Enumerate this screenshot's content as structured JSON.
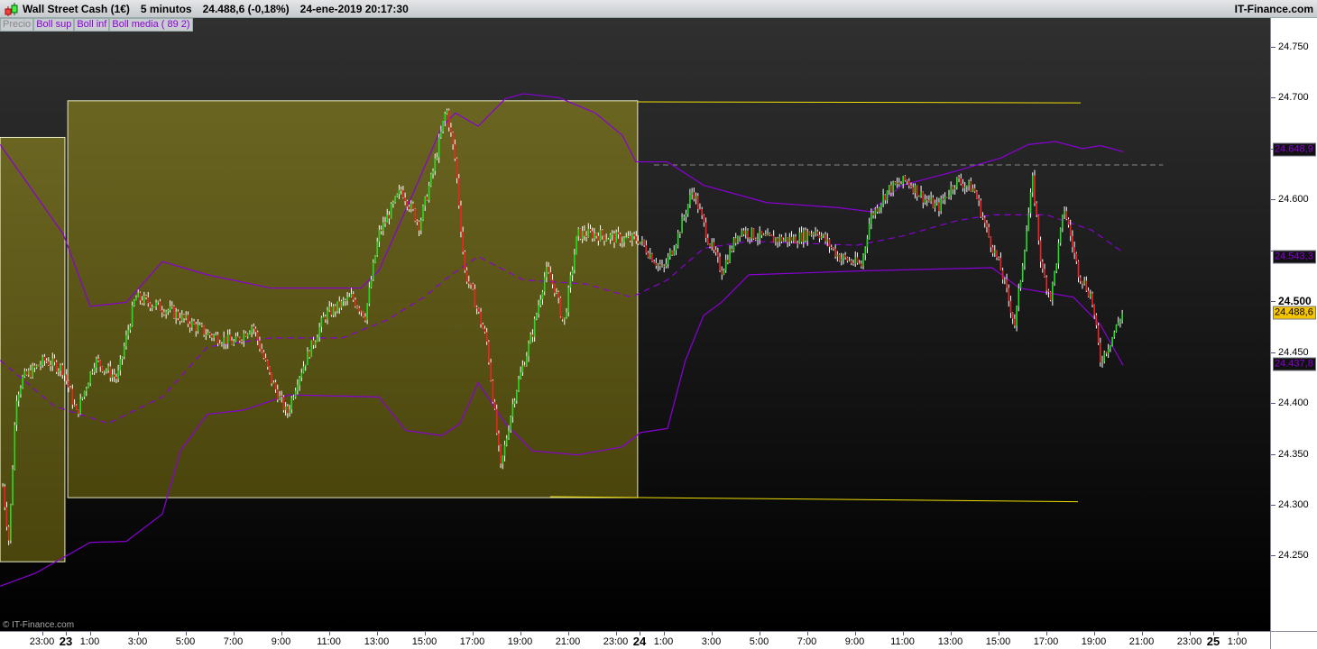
{
  "header": {
    "instrument": "Wall Street Cash (1€)",
    "timeframe": "5 minutos",
    "last": "24.488,6 (-0,18%)",
    "datetime": "24-ene-2019 20:17:30",
    "brand": "IT-Finance.com"
  },
  "legend": [
    "Precio",
    "Boll sup",
    "Boll inf",
    "Boll media ( 89 2)"
  ],
  "copyright": "© IT-Finance.com",
  "colors": {
    "band": "#8a00d6",
    "box": "#6b6520",
    "line": "#f0e000",
    "up": "#22dd22",
    "down": "#ee2222"
  },
  "chart_data": {
    "type": "candlestick",
    "time_unit": "hours since 22-ene-2019 00:00",
    "ylim": [
      24.18,
      24.78
    ],
    "y_ticks": [
      {
        "v": 24.75,
        "label": "24.750"
      },
      {
        "v": 24.7,
        "label": "24.700"
      },
      {
        "v": 24.65,
        "label": ""
      },
      {
        "v": 24.6,
        "label": "24.600"
      },
      {
        "v": 24.55,
        "label": ""
      },
      {
        "v": 24.5,
        "label": "24.500",
        "bold": true
      },
      {
        "v": 24.45,
        "label": "24.450"
      },
      {
        "v": 24.4,
        "label": "24.400"
      },
      {
        "v": 24.35,
        "label": "24.350"
      },
      {
        "v": 24.3,
        "label": "24.300"
      },
      {
        "v": 24.25,
        "label": "24.250"
      }
    ],
    "x_ticks": [
      {
        "t": 23,
        "label": "23:00"
      },
      {
        "t": 24,
        "label": "23",
        "bold": true
      },
      {
        "t": 25,
        "label": "1:00"
      },
      {
        "t": 27,
        "label": "3:00"
      },
      {
        "t": 29,
        "label": "5:00"
      },
      {
        "t": 31,
        "label": "7:00"
      },
      {
        "t": 33,
        "label": "9:00"
      },
      {
        "t": 35,
        "label": "11:00"
      },
      {
        "t": 37,
        "label": "13:00"
      },
      {
        "t": 39,
        "label": "15:00"
      },
      {
        "t": 41,
        "label": "17:00"
      },
      {
        "t": 43,
        "label": "19:00"
      },
      {
        "t": 45,
        "label": "21:00"
      },
      {
        "t": 47,
        "label": "23:00"
      },
      {
        "t": 48,
        "label": "24",
        "bold": true
      },
      {
        "t": 49,
        "label": "1:00"
      },
      {
        "t": 51,
        "label": "3:00"
      },
      {
        "t": 53,
        "label": "5:00"
      },
      {
        "t": 55,
        "label": "7:00"
      },
      {
        "t": 57,
        "label": "9:00"
      },
      {
        "t": 59,
        "label": "11:00"
      },
      {
        "t": 61,
        "label": "13:00"
      },
      {
        "t": 63,
        "label": "15:00"
      },
      {
        "t": 65,
        "label": "17:00"
      },
      {
        "t": 67,
        "label": "19:00"
      },
      {
        "t": 69,
        "label": "21:00"
      },
      {
        "t": 71,
        "label": "23:00"
      },
      {
        "t": 72,
        "label": "25",
        "bold": true
      },
      {
        "t": 73,
        "label": "1:00"
      }
    ],
    "badges": [
      {
        "v": 24.6489,
        "label": "24.648,9",
        "kind": "band"
      },
      {
        "v": 24.5433,
        "label": "24.543,3",
        "kind": "band"
      },
      {
        "v": 24.4886,
        "label": "24.488,6",
        "kind": "last"
      },
      {
        "v": 24.4378,
        "label": "24.437,8",
        "kind": "band"
      }
    ],
    "price_path": [
      [
        21.36,
        24.318
      ],
      [
        21.62,
        24.264
      ],
      [
        21.92,
        24.406
      ],
      [
        22.19,
        24.424
      ],
      [
        23.13,
        24.442
      ],
      [
        23.89,
        24.433
      ],
      [
        24.45,
        24.389
      ],
      [
        25.21,
        24.442
      ],
      [
        26.15,
        24.424
      ],
      [
        26.91,
        24.504
      ],
      [
        28.42,
        24.49
      ],
      [
        29.92,
        24.468
      ],
      [
        31.06,
        24.459
      ],
      [
        31.81,
        24.477
      ],
      [
        32.57,
        24.424
      ],
      [
        33.25,
        24.389
      ],
      [
        33.7,
        24.424
      ],
      [
        34.83,
        24.486
      ],
      [
        35.96,
        24.504
      ],
      [
        36.53,
        24.486
      ],
      [
        37.09,
        24.566
      ],
      [
        38.04,
        24.61
      ],
      [
        38.79,
        24.575
      ],
      [
        39.36,
        24.628
      ],
      [
        39.92,
        24.69
      ],
      [
        40.3,
        24.637
      ],
      [
        40.68,
        24.53
      ],
      [
        41.06,
        24.504
      ],
      [
        41.62,
        24.459
      ],
      [
        42.19,
        24.335
      ],
      [
        42.75,
        24.406
      ],
      [
        43.51,
        24.468
      ],
      [
        44.08,
        24.53
      ],
      [
        44.45,
        24.513
      ],
      [
        44.83,
        24.477
      ],
      [
        45.4,
        24.566
      ],
      [
        46.15,
        24.566
      ],
      [
        47.28,
        24.561
      ],
      [
        47.96,
        24.561
      ],
      [
        48.98,
        24.53
      ],
      [
        49.55,
        24.561
      ],
      [
        50.23,
        24.61
      ],
      [
        50.87,
        24.561
      ],
      [
        51.43,
        24.53
      ],
      [
        52.19,
        24.57
      ],
      [
        53.32,
        24.561
      ],
      [
        54.45,
        24.561
      ],
      [
        55.4,
        24.57
      ],
      [
        56.34,
        24.544
      ],
      [
        57.28,
        24.535
      ],
      [
        57.66,
        24.583
      ],
      [
        58.42,
        24.61
      ],
      [
        59.17,
        24.619
      ],
      [
        59.92,
        24.601
      ],
      [
        60.49,
        24.592
      ],
      [
        61.25,
        24.619
      ],
      [
        62.0,
        24.61
      ],
      [
        62.57,
        24.566
      ],
      [
        63.13,
        24.53
      ],
      [
        63.7,
        24.477
      ],
      [
        64.45,
        24.619
      ],
      [
        64.83,
        24.53
      ],
      [
        65.21,
        24.504
      ],
      [
        65.77,
        24.592
      ],
      [
        66.34,
        24.53
      ],
      [
        66.91,
        24.504
      ],
      [
        67.28,
        24.442
      ],
      [
        67.66,
        24.459
      ],
      [
        68.23,
        24.49
      ]
    ],
    "series": [
      {
        "name": "Boll sup",
        "style": "solid",
        "points": [
          [
            21.25,
            24.654
          ],
          [
            23.89,
            24.566
          ],
          [
            25.02,
            24.495
          ],
          [
            26.53,
            24.499
          ],
          [
            28.04,
            24.539
          ],
          [
            29.92,
            24.526
          ],
          [
            32.57,
            24.513
          ],
          [
            36.34,
            24.513
          ],
          [
            37.09,
            24.53
          ],
          [
            38.6,
            24.61
          ],
          [
            39.74,
            24.672
          ],
          [
            40.3,
            24.685
          ],
          [
            41.25,
            24.672
          ],
          [
            42.38,
            24.699
          ],
          [
            43.13,
            24.704
          ],
          [
            44.64,
            24.7
          ],
          [
            46.15,
            24.685
          ],
          [
            47.28,
            24.663
          ],
          [
            47.85,
            24.637
          ],
          [
            49.17,
            24.637
          ],
          [
            50.68,
            24.614
          ],
          [
            53.32,
            24.597
          ],
          [
            56.34,
            24.592
          ],
          [
            57.66,
            24.588
          ],
          [
            58.98,
            24.614
          ],
          [
            61.25,
            24.628
          ],
          [
            63.13,
            24.641
          ],
          [
            64.26,
            24.654
          ],
          [
            65.4,
            24.657
          ],
          [
            66.53,
            24.65
          ],
          [
            67.28,
            24.653
          ],
          [
            68.23,
            24.647
          ]
        ]
      },
      {
        "name": "Boll inf",
        "style": "solid",
        "points": [
          [
            21.25,
            24.22
          ],
          [
            22.75,
            24.233
          ],
          [
            25.02,
            24.263
          ],
          [
            26.53,
            24.264
          ],
          [
            28.04,
            24.291
          ],
          [
            28.79,
            24.353
          ],
          [
            29.92,
            24.389
          ],
          [
            31.43,
            24.393
          ],
          [
            33.32,
            24.408
          ],
          [
            37.09,
            24.406
          ],
          [
            38.23,
            24.373
          ],
          [
            39.74,
            24.368
          ],
          [
            40.49,
            24.38
          ],
          [
            41.25,
            24.42
          ],
          [
            42.38,
            24.38
          ],
          [
            43.51,
            24.353
          ],
          [
            45.4,
            24.349
          ],
          [
            47.28,
            24.357
          ],
          [
            48.04,
            24.371
          ],
          [
            49.17,
            24.375
          ],
          [
            49.92,
            24.442
          ],
          [
            50.68,
            24.486
          ],
          [
            51.43,
            24.499
          ],
          [
            52.57,
            24.526
          ],
          [
            57.47,
            24.53
          ],
          [
            62.75,
            24.533
          ],
          [
            63.89,
            24.513
          ],
          [
            66.15,
            24.504
          ],
          [
            67.28,
            24.477
          ],
          [
            68.23,
            24.437
          ]
        ]
      },
      {
        "name": "Boll media ( 89 2)",
        "style": "dashed",
        "points": [
          [
            21.25,
            24.442
          ],
          [
            23.51,
            24.397
          ],
          [
            25.77,
            24.38
          ],
          [
            28.04,
            24.406
          ],
          [
            29.92,
            24.455
          ],
          [
            32.57,
            24.464
          ],
          [
            35.58,
            24.464
          ],
          [
            37.47,
            24.482
          ],
          [
            38.98,
            24.504
          ],
          [
            40.11,
            24.526
          ],
          [
            41.25,
            24.544
          ],
          [
            43.13,
            24.521
          ],
          [
            45.77,
            24.517
          ],
          [
            47.66,
            24.504
          ],
          [
            49.17,
            24.521
          ],
          [
            50.68,
            24.552
          ],
          [
            52.57,
            24.559
          ],
          [
            57.09,
            24.555
          ],
          [
            58.98,
            24.564
          ],
          [
            61.25,
            24.579
          ],
          [
            62.75,
            24.585
          ],
          [
            65.02,
            24.585
          ],
          [
            66.91,
            24.57
          ],
          [
            68.23,
            24.548
          ]
        ]
      }
    ],
    "range_boxes": [
      {
        "t0": 21.25,
        "t1": 23.96,
        "high": 24.661,
        "low": 24.244
      },
      {
        "t0": 24.08,
        "t1": 47.92,
        "high": 24.697,
        "low": 24.307
      }
    ],
    "trend_lines": [
      {
        "t0": 47.92,
        "p0": 24.696,
        "t1": 66.45,
        "p1": 24.695
      },
      {
        "t0": 44.26,
        "p0": 24.308,
        "t1": 66.34,
        "p1": 24.303
      }
    ],
    "reference_line": {
      "price": 24.634,
      "t0": 48.6,
      "t1": 69.9
    }
  }
}
